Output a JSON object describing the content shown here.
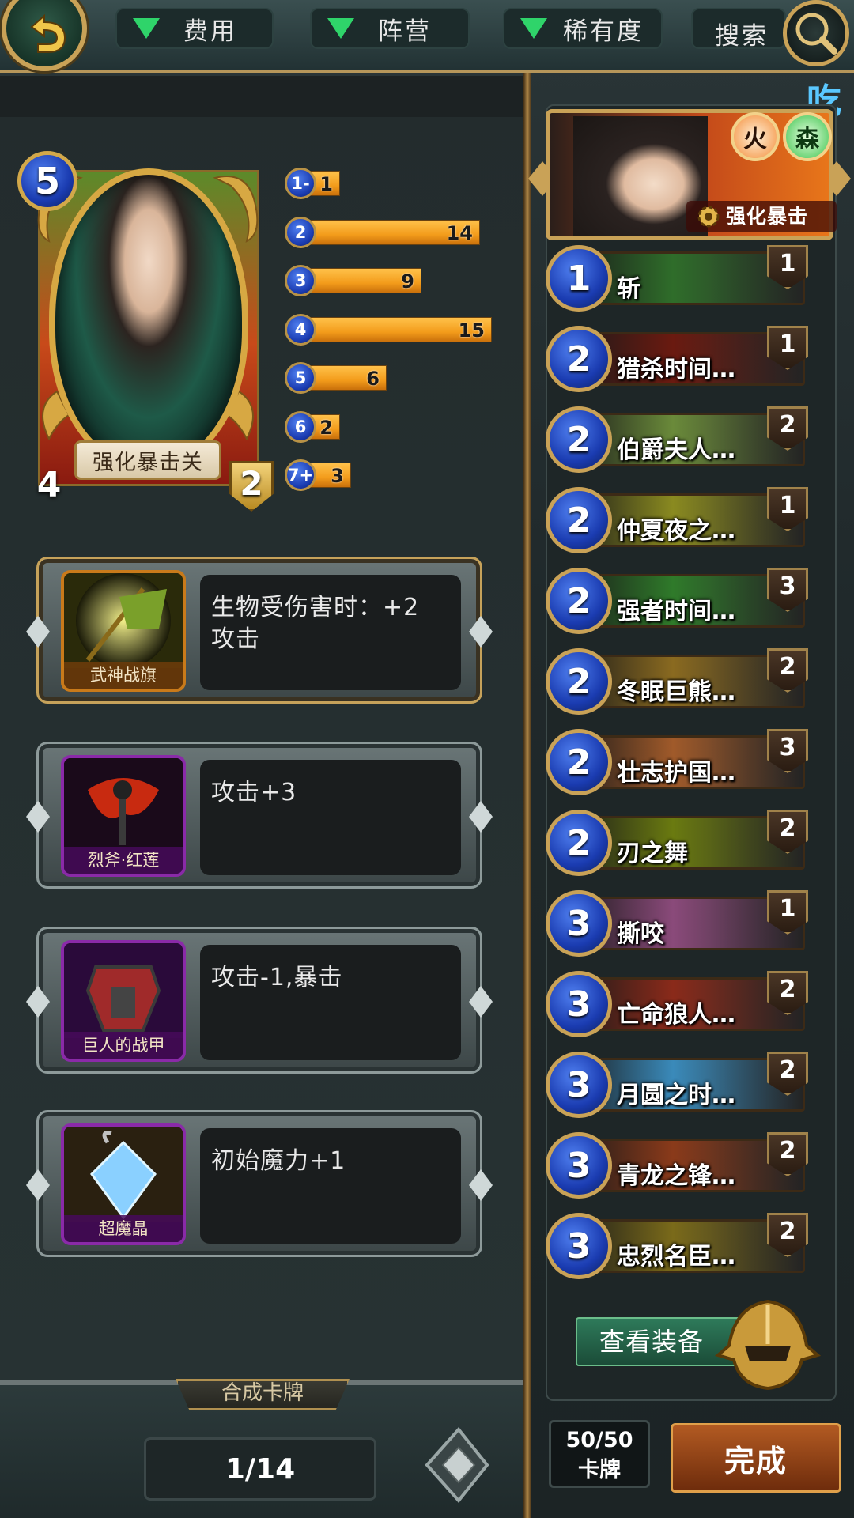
{
  "topbar": {
    "filters": [
      {
        "label": "费用"
      },
      {
        "label": "阵营"
      },
      {
        "label": "稀有度"
      }
    ],
    "search_label": "搜索",
    "corner_text": "吃"
  },
  "hero": {
    "cost": "5",
    "name": "强化暴击关",
    "attack": "4",
    "health": "2"
  },
  "cost_histogram": [
    {
      "cost": "1-",
      "count": 1
    },
    {
      "cost": "2",
      "count": 14
    },
    {
      "cost": "3",
      "count": 9
    },
    {
      "cost": "4",
      "count": 15
    },
    {
      "cost": "5",
      "count": 6
    },
    {
      "cost": "6",
      "count": 2
    },
    {
      "cost": "7+",
      "count": 3
    }
  ],
  "equipment": [
    {
      "name": "武神战旗",
      "desc": "生物受伤害时：+2 攻击",
      "border": "gold"
    },
    {
      "name": "烈斧·红莲",
      "desc": "攻击+3",
      "border": "purple"
    },
    {
      "name": "巨人的战甲",
      "desc": "攻击-1,暴击",
      "border": "purple"
    },
    {
      "name": "超魔晶",
      "desc": "初始魔力+1",
      "border": "purple"
    }
  ],
  "bottom": {
    "synth_tab": "合成卡牌",
    "page": "1/14"
  },
  "deck_hero": {
    "element_fire": "火",
    "element_forest": "森",
    "skill": "强化暴击"
  },
  "deck": [
    {
      "cost": "1",
      "name": "斩",
      "count": "1",
      "color": "#2f6d2a"
    },
    {
      "cost": "2",
      "name": "猎杀时间…",
      "count": "1",
      "color": "#6a1a10"
    },
    {
      "cost": "2",
      "name": "伯爵夫人…",
      "count": "2",
      "color": "#6a8a3a"
    },
    {
      "cost": "2",
      "name": "仲夏夜之…",
      "count": "1",
      "color": "#8a8a20"
    },
    {
      "cost": "2",
      "name": "强者时间…",
      "count": "3",
      "color": "#2f7a2a"
    },
    {
      "cost": "2",
      "name": "冬眠巨熊…",
      "count": "2",
      "color": "#8a6a20"
    },
    {
      "cost": "2",
      "name": "壮志护国…",
      "count": "3",
      "color": "#a05a2a"
    },
    {
      "cost": "2",
      "name": "刃之舞",
      "count": "2",
      "color": "#6a7a10"
    },
    {
      "cost": "3",
      "name": "撕咬",
      "count": "1",
      "color": "#8a4a7a"
    },
    {
      "cost": "3",
      "name": "亡命狼人…",
      "count": "2",
      "color": "#8a2a1a"
    },
    {
      "cost": "3",
      "name": "月圆之时…",
      "count": "2",
      "color": "#3a8aba"
    },
    {
      "cost": "3",
      "name": "青龙之锋…",
      "count": "2",
      "color": "#8a3a1a"
    },
    {
      "cost": "3",
      "name": "忠烈名臣…",
      "count": "2",
      "color": "#7a6a1a"
    }
  ],
  "view_equip_label": "查看装备",
  "deck_count": {
    "value": "50/50",
    "label": "卡牌"
  },
  "done_label": "完成"
}
